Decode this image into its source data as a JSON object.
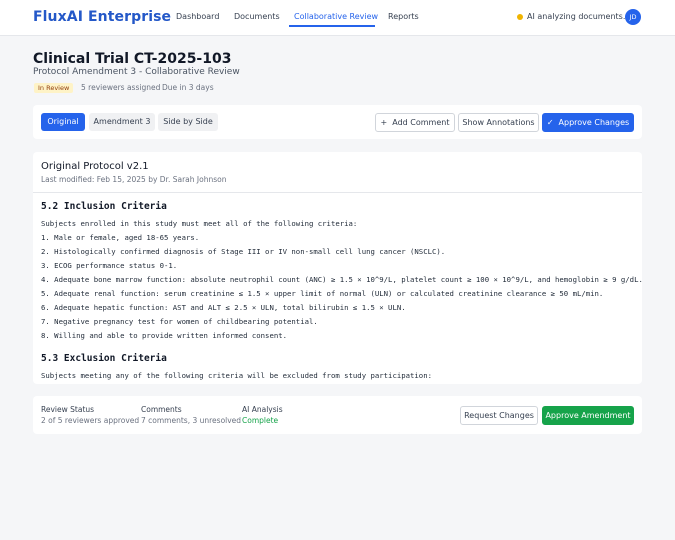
{
  "header": {
    "brand": "FluxAI Enterprise",
    "nav": [
      "Dashboard",
      "Documents",
      "Collaborative Review",
      "Reports"
    ],
    "active_nav": "Collaborative Review",
    "ai_status": "AI analyzing documents...",
    "avatar_initials": "JD",
    "status_dot_color": "#f0b400",
    "accent_color": "#2563eb"
  },
  "page": {
    "title": "Clinical Trial CT-2025-103",
    "subtitle": "Protocol Amendment 3 - Collaborative Review",
    "badge": "In Review",
    "reviewers": "5 reviewers assigned",
    "due": "Due in 3 days"
  },
  "toolbar": {
    "tabs": [
      "Original",
      "Amendment 3",
      "Side by Side"
    ],
    "active_tab": "Original",
    "add_comment": "Add Comment",
    "show_annotations": "Show Annotations",
    "approve_changes": "Approve Changes"
  },
  "document": {
    "title": "Original Protocol v2.1",
    "meta": "Last modified: Feb 15, 2025 by Dr. Sarah Johnson",
    "inclusion_heading": "5.2 Inclusion Criteria",
    "inclusion_intro": "Subjects enrolled in this study must meet all of the following criteria:",
    "inclusion_items": [
      "1. Male or female, aged 18-65 years.",
      "2. Histologically confirmed diagnosis of Stage III or IV non-small cell lung cancer (NSCLC).",
      "3. ECOG performance status 0-1.",
      "4. Adequate bone marrow function: absolute neutrophil count (ANC) ≥ 1.5 × 10^9/L, platelet count ≥ 100 × 10^9/L, and hemoglobin ≥ 9 g/dL.",
      "5. Adequate renal function: serum creatinine ≤ 1.5 × upper limit of normal (ULN) or calculated creatinine clearance ≥ 50 mL/min.",
      "6. Adequate hepatic function: AST and ALT ≤ 2.5 × ULN, total bilirubin ≤ 1.5 × ULN.",
      "7. Negative pregnancy test for women of childbearing potential.",
      "8. Willing and able to provide written informed consent."
    ],
    "exclusion_heading": "5.3 Exclusion Criteria",
    "exclusion_intro": "Subjects meeting any of the following criteria will be excluded from study participation:"
  },
  "footer": {
    "review_status_label": "Review Status",
    "review_status_value": "2 of 5 reviewers approved",
    "comments_label": "Comments",
    "comments_value": "7 comments, 3 unresolved",
    "ai_label": "AI Analysis",
    "ai_value": "Complete",
    "request_changes": "Request Changes",
    "approve_amendment": "Approve Amendment"
  }
}
